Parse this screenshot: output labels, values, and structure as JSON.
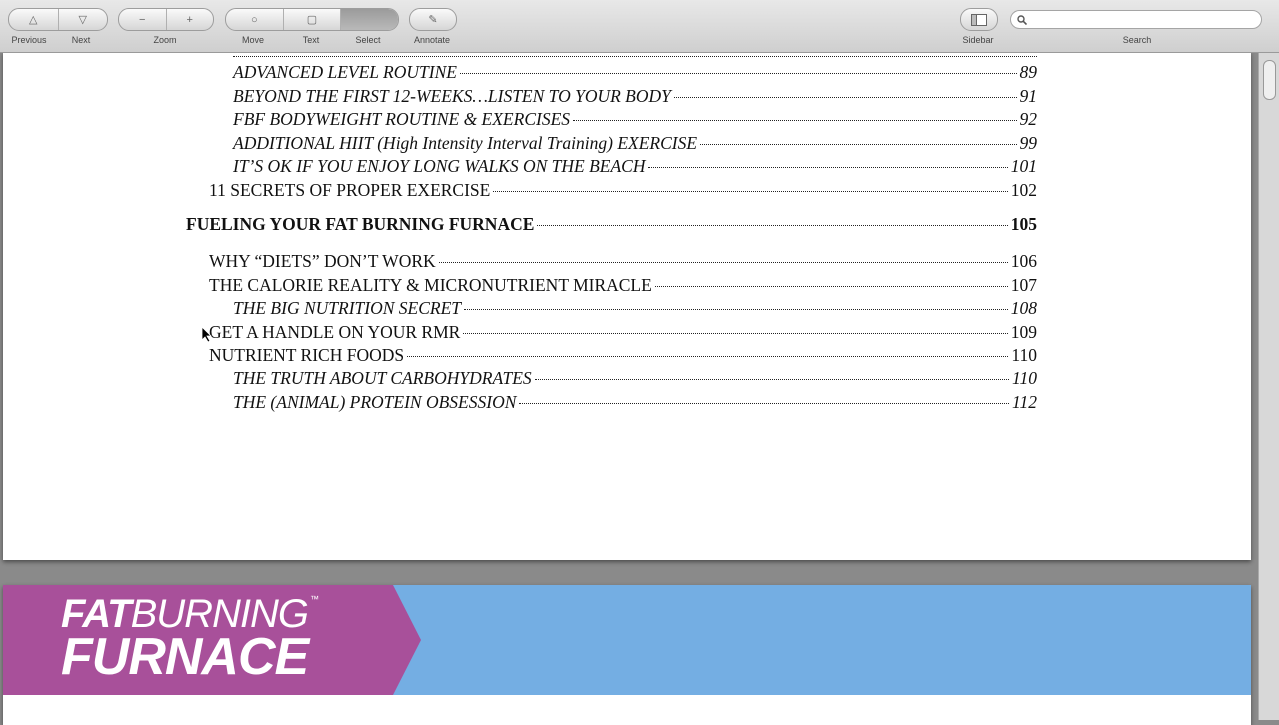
{
  "toolbar": {
    "previous_label": "Previous",
    "next_label": "Next",
    "zoom_label": "Zoom",
    "move_label": "Move",
    "text_label": "Text",
    "select_label": "Select",
    "annotate_label": "Annotate",
    "sidebar_label": "Sidebar",
    "search_label": "Search",
    "search_placeholder": ""
  },
  "toc": {
    "entries": [
      {
        "title": "ADVANCED LEVEL ROUTINE",
        "page": "89",
        "level": "sub"
      },
      {
        "title": "BEYOND THE FIRST 12-WEEKS…LISTEN TO YOUR BODY",
        "page": "91",
        "level": "sub"
      },
      {
        "title": "FBF BODYWEIGHT ROUTINE & EXERCISES",
        "page": "92",
        "level": "sub"
      },
      {
        "title": "ADDITIONAL HIIT (High Intensity Interval Training) EXERCISE",
        "page": "99",
        "level": "sub"
      },
      {
        "title": "IT’S OK IF YOU ENJOY LONG WALKS ON THE BEACH",
        "page": "101",
        "level": "sub"
      },
      {
        "title": "11 SECRETS OF PROPER EXERCISE",
        "page": "102",
        "level": "main"
      },
      {
        "title": "FUELING YOUR FAT BURNING FURNACE",
        "page": "105",
        "level": "head"
      },
      {
        "title": "WHY “DIETS” DON’T WORK",
        "page": "106",
        "level": "main"
      },
      {
        "title": "THE CALORIE REALITY & MICRONUTRIENT MIRACLE",
        "page": "107",
        "level": "main"
      },
      {
        "title": "THE BIG NUTRITION SECRET",
        "page": "108",
        "level": "sub"
      },
      {
        "title": "GET A HANDLE ON YOUR RMR",
        "page": "109",
        "level": "main"
      },
      {
        "title": "NUTRIENT RICH FOODS",
        "page": "110",
        "level": "main"
      },
      {
        "title": "THE TRUTH ABOUT CARBOHYDRATES",
        "page": "110",
        "level": "sub"
      },
      {
        "title": "THE (ANIMAL) PROTEIN OBSESSION",
        "page": "112",
        "level": "sub"
      }
    ]
  },
  "banner": {
    "logo_line1_bold": "FAT",
    "logo_line1_rest": "BURNING",
    "logo_line2": "FURNACE",
    "trademark": "™",
    "colors": {
      "purple": "#a8509a",
      "blue": "#74aee3"
    }
  }
}
